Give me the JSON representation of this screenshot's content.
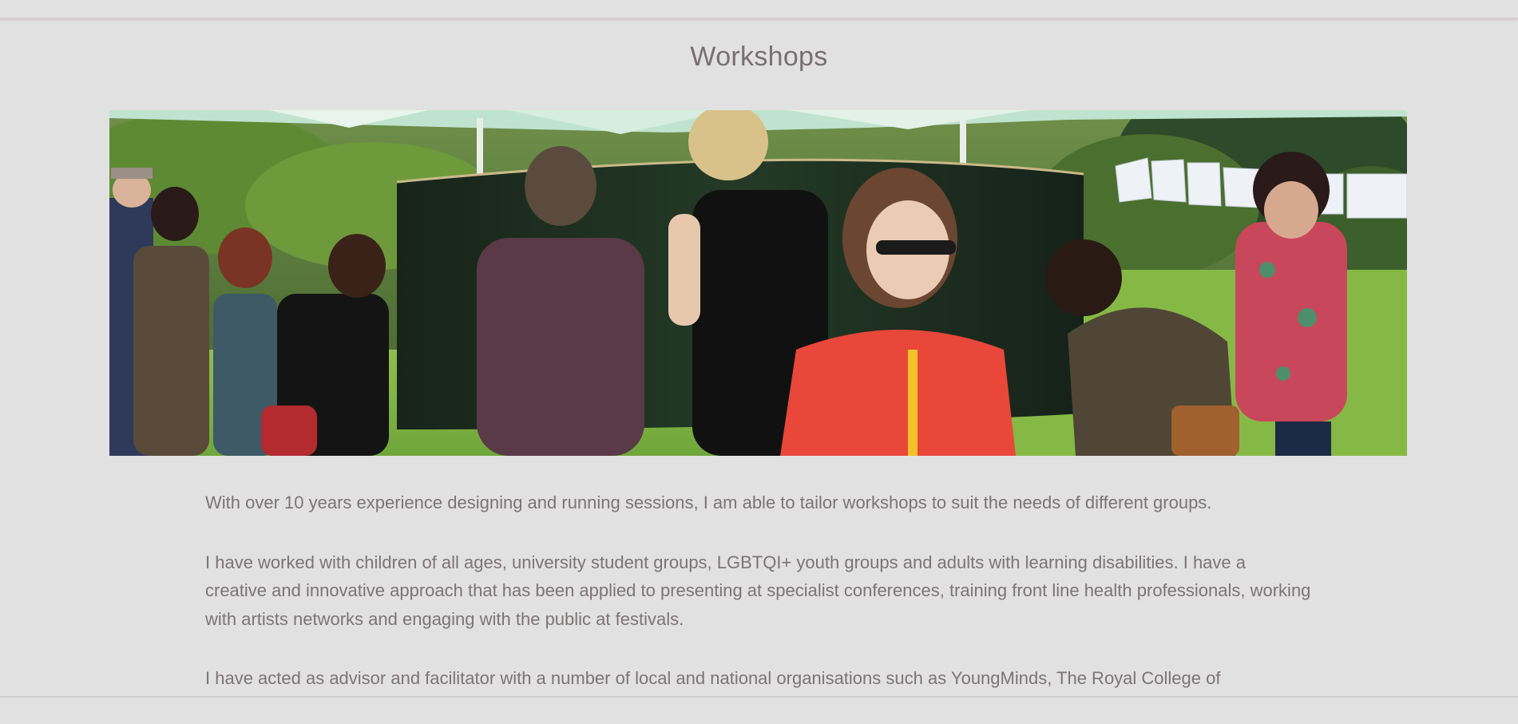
{
  "page": {
    "title": "Workshops"
  },
  "hero_image": {
    "alt": "People writing on a large curved panel under a gazebo at an outdoor festival",
    "icon": "photo"
  },
  "content": {
    "paragraphs": [
      "With over 10 years experience designing and running sessions, I am able to tailor workshops to suit the needs of different groups.",
      "I have worked with children of all ages, university student groups, LGBTQI+ youth groups and adults with learning disabilities. I have a creative and innovative approach that has been applied to presenting at specialist conferences, training front line health professionals, working with artists networks and engaging with the public at festivals.",
      "I have acted as advisor and facilitator with a number of local and national organisations such as YoungMinds, The Royal College of"
    ]
  },
  "colors": {
    "background": "#e2e1e1",
    "text": "#7a7475",
    "title": "#777072",
    "top_border": "#d6cdd0"
  }
}
